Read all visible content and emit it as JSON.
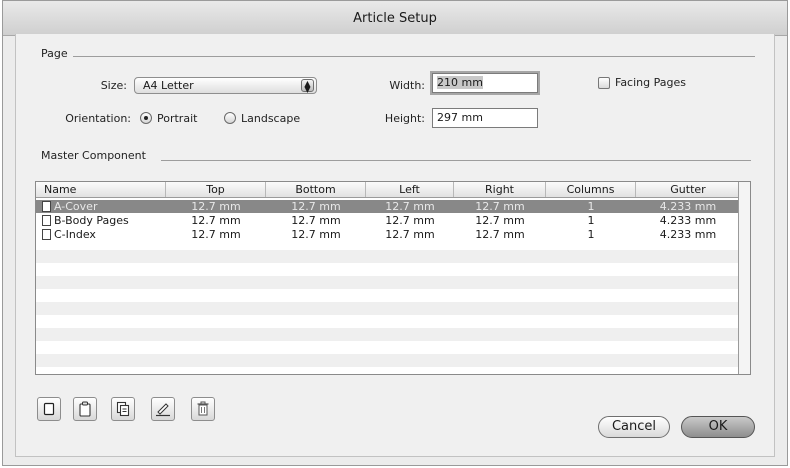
{
  "window": {
    "title": "Article Setup"
  },
  "page_group": {
    "label": "Page",
    "size_label": "Size:",
    "size_value": "A4 Letter",
    "orientation_label": "Orientation:",
    "portrait_label": "Portrait",
    "landscape_label": "Landscape",
    "orientation_selected": "Portrait",
    "width_label": "Width:",
    "width_value": "210 mm",
    "height_label": "Height:",
    "height_value": "297 mm",
    "facing_pages_label": "Facing Pages",
    "facing_pages_checked": false
  },
  "master_group": {
    "label": "Master Component",
    "columns": [
      "Name",
      "Top",
      "Bottom",
      "Left",
      "Right",
      "Columns",
      "Gutter"
    ],
    "rows": [
      {
        "name": "A-Cover",
        "top": "12.7 mm",
        "bottom": "12.7 mm",
        "left": "12.7 mm",
        "right": "12.7 mm",
        "columns": "1",
        "gutter": "4.233 mm",
        "selected": true
      },
      {
        "name": "B-Body Pages",
        "top": "12.7 mm",
        "bottom": "12.7 mm",
        "left": "12.7 mm",
        "right": "12.7 mm",
        "columns": "1",
        "gutter": "4.233 mm",
        "selected": false
      },
      {
        "name": "C-Index",
        "top": "12.7 mm",
        "bottom": "12.7 mm",
        "left": "12.7 mm",
        "right": "12.7 mm",
        "columns": "1",
        "gutter": "4.233 mm",
        "selected": false
      }
    ]
  },
  "toolbar": {
    "icons": [
      "new-page-icon",
      "duplicate-icon",
      "copy-icon",
      "edit-icon",
      "trash-icon"
    ]
  },
  "buttons": {
    "cancel": "Cancel",
    "ok": "OK"
  },
  "colors": {
    "selection": "#888888",
    "stripe": "#efefef",
    "window_bg": "#ececec"
  }
}
